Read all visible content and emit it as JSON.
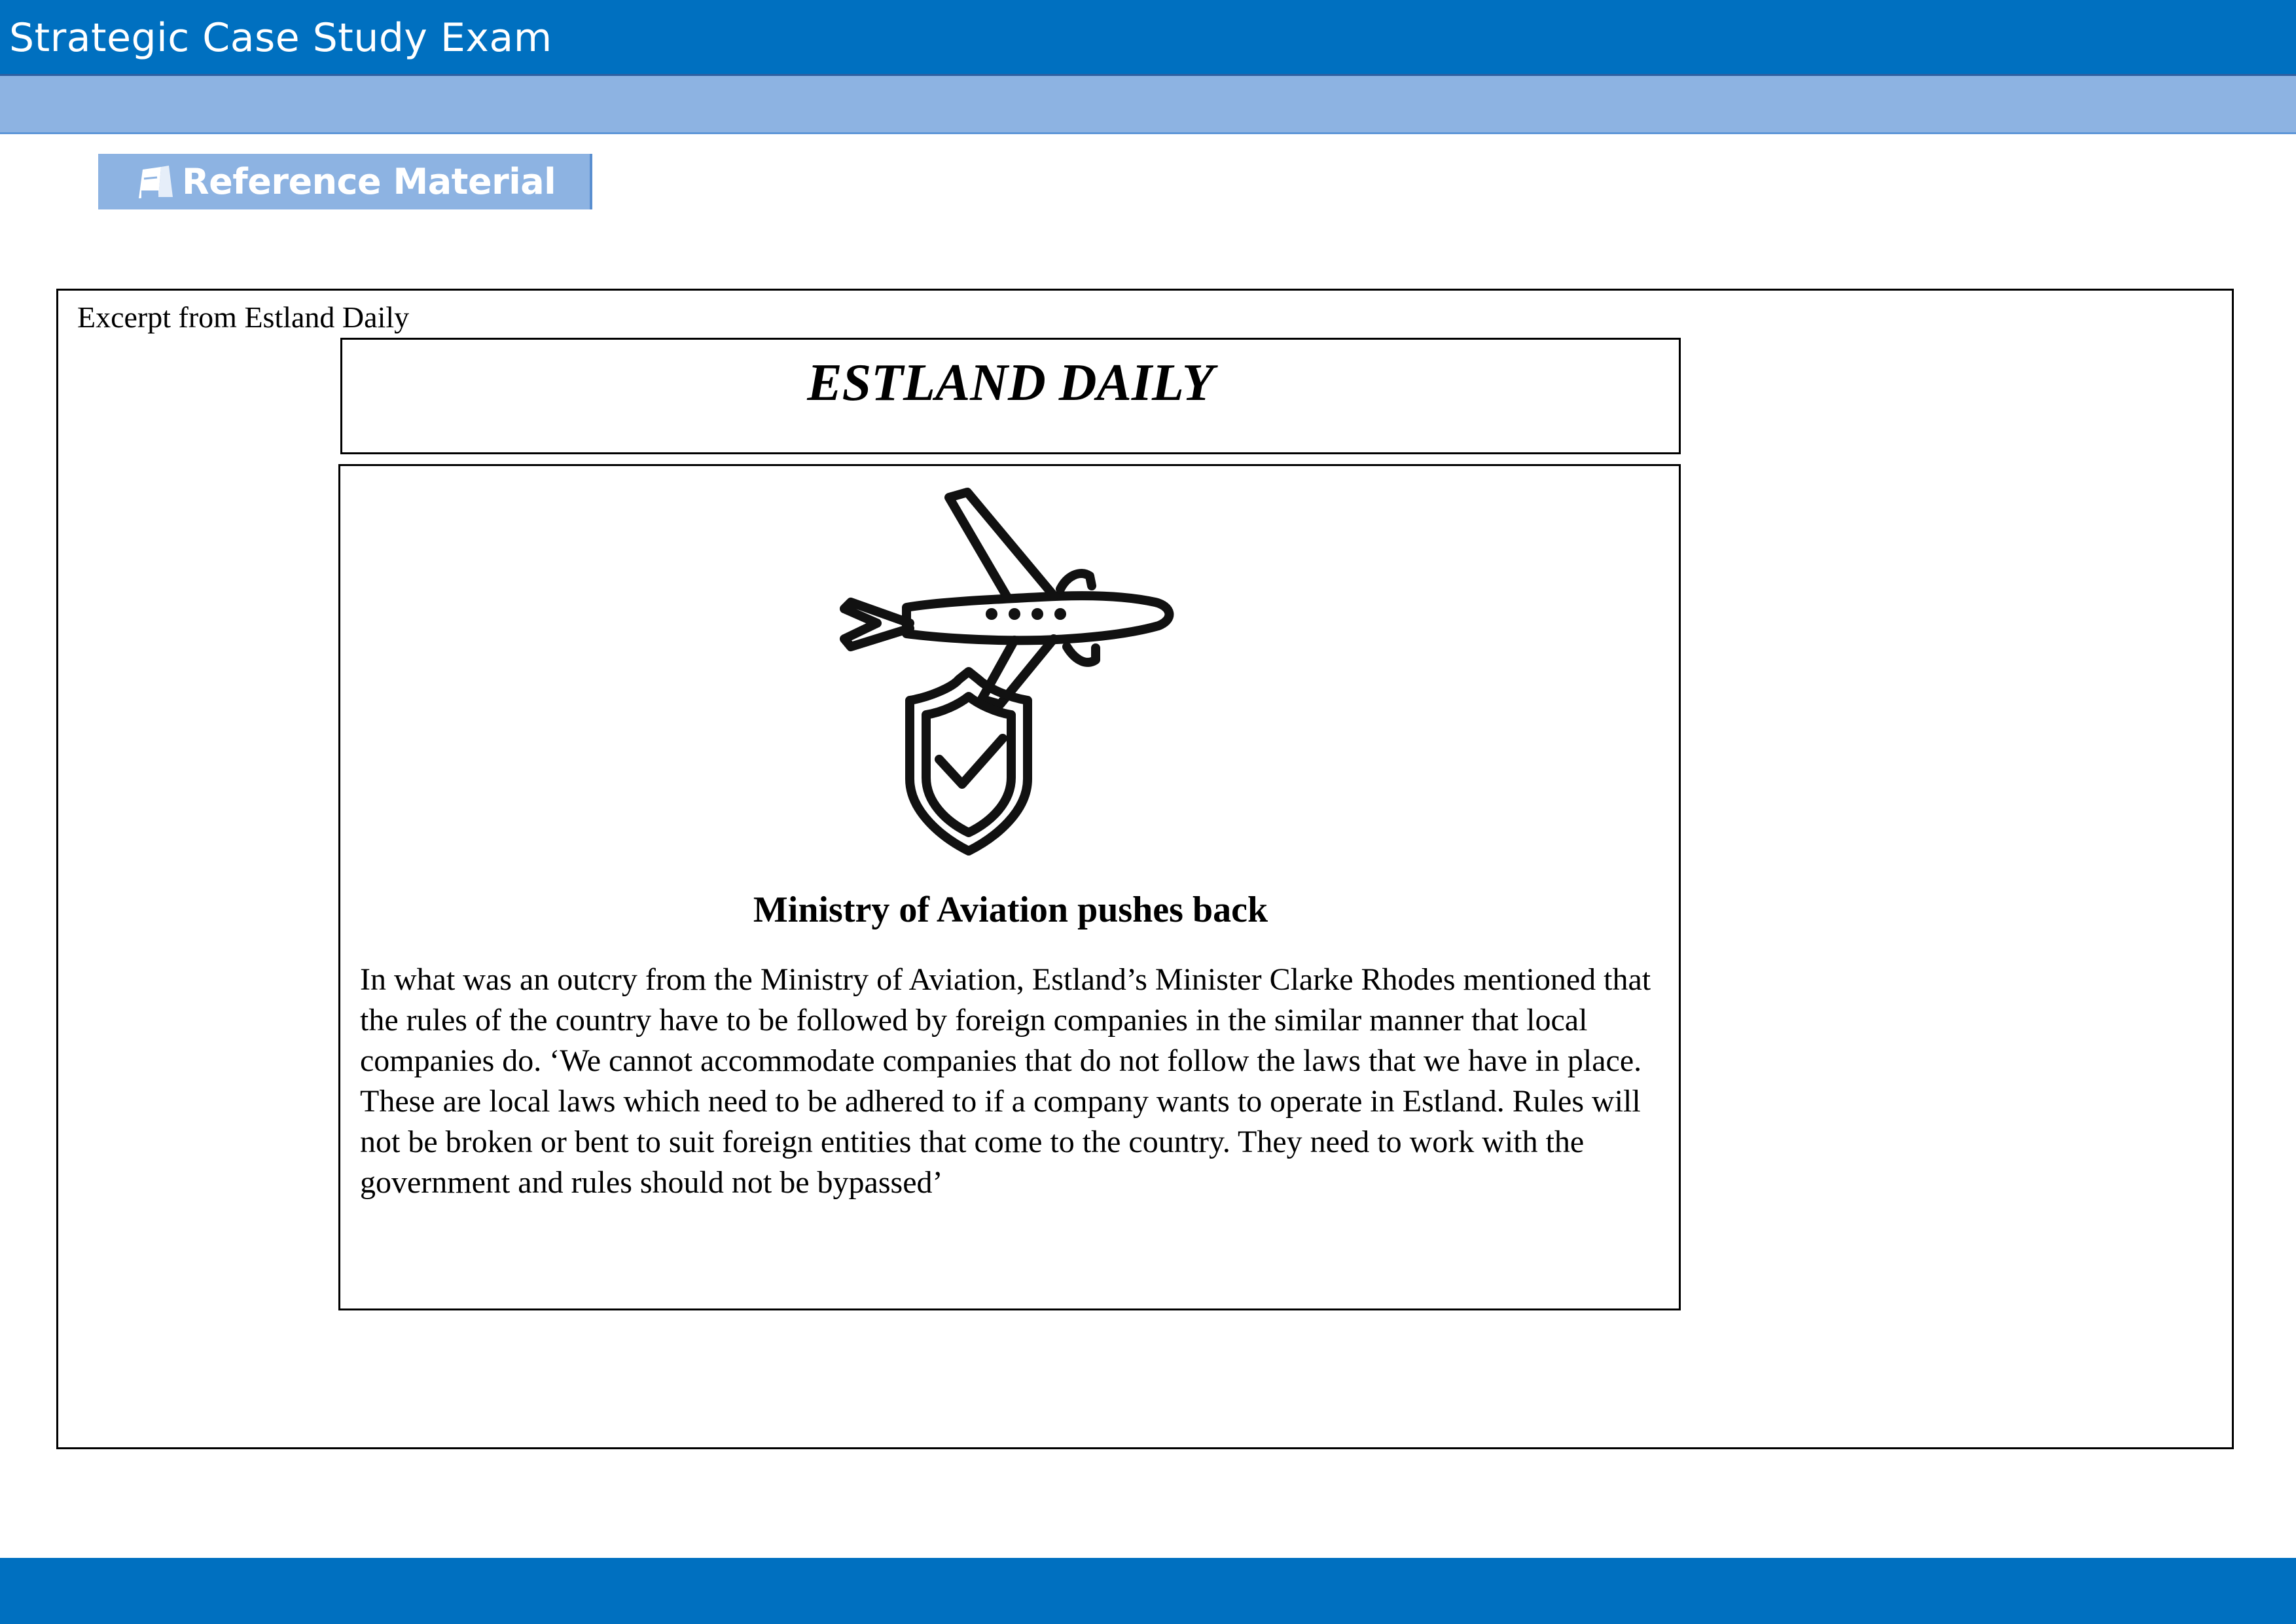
{
  "header": {
    "title": "Strategic Case Study Exam"
  },
  "toolbar": {
    "reference_label": "Reference Material",
    "reference_icon": "reference-book-icon"
  },
  "content": {
    "excerpt_label": "Excerpt from Estland Daily",
    "masthead": "ESTLAND DAILY",
    "image_icon": "airplane-shield-check-icon",
    "headline": "Ministry of Aviation pushes back",
    "body": "In what was an outcry from the Ministry of Aviation, Estland’s Minister Clarke Rhodes mentioned that the rules of the country have to be followed by foreign companies in the similar manner that local companies do. ‘We cannot accommodate companies that do not follow the laws that we have in place. These are local laws which need to be adhered to if a company wants to operate in Estland. Rules will not be broken or bent to suit foreign entities that come to the country. They need to work with the government and rules should not be bypassed’"
  },
  "colors": {
    "header_bg": "#0070c0",
    "subbar_bg": "#8db3e2",
    "footer_bg": "#0070c0"
  }
}
